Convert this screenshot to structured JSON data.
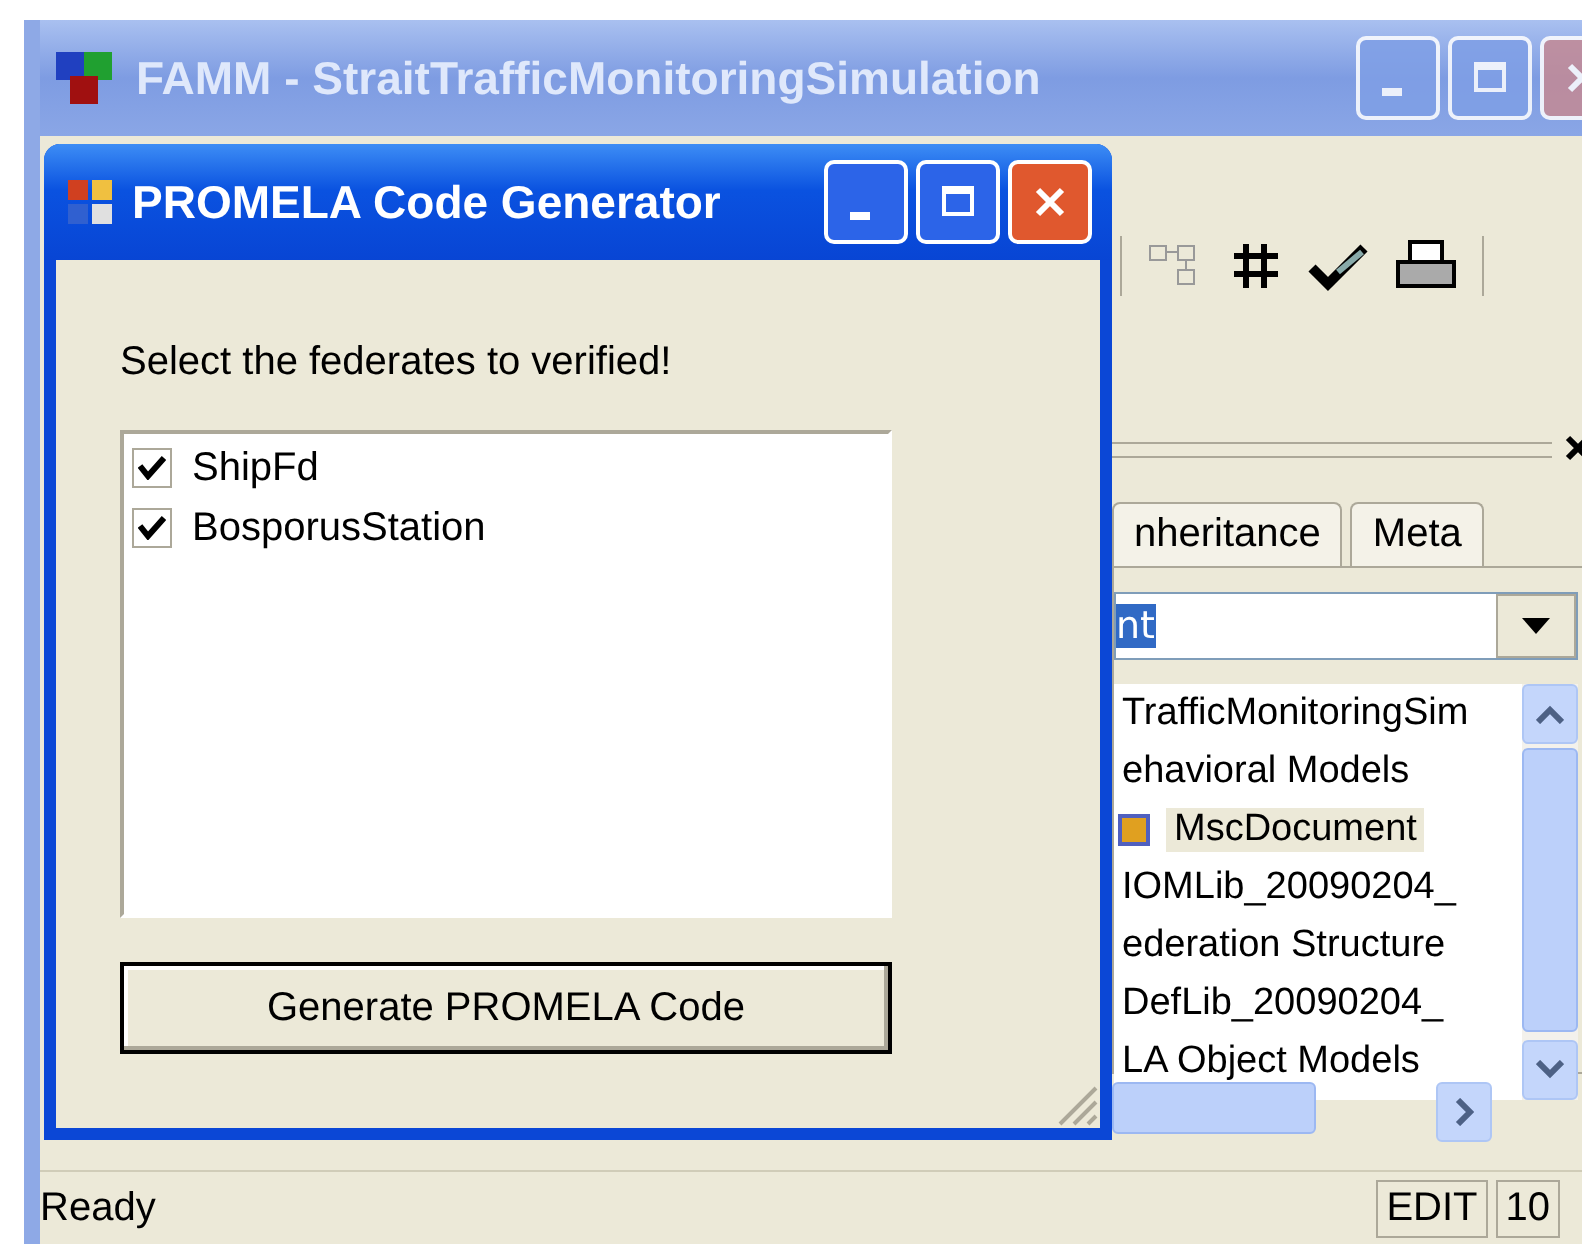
{
  "main_window": {
    "title": "FAMM - StraitTrafficMonitoringSimulation"
  },
  "panel": {
    "tabs": [
      {
        "label": "nheritance",
        "selected": false
      },
      {
        "label": "Meta",
        "selected": false
      }
    ],
    "combo": {
      "value": "nt"
    },
    "tree": [
      {
        "label": "TrafficMonitoringSim",
        "kind": "text",
        "selected": false
      },
      {
        "label": "ehavioral Models",
        "kind": "text",
        "selected": false
      },
      {
        "label": "MscDocument",
        "kind": "document",
        "selected": true
      },
      {
        "label": "IOMLib_20090204_",
        "kind": "text",
        "selected": false
      },
      {
        "label": "ederation Structure",
        "kind": "text",
        "selected": false
      },
      {
        "label": "DefLib_20090204_",
        "kind": "text",
        "selected": false
      },
      {
        "label": "LA Object Models",
        "kind": "text",
        "selected": false
      }
    ]
  },
  "status_bar": {
    "message": "Ready",
    "mode": "EDIT",
    "column_3": "10"
  },
  "dialog": {
    "title": "PROMELA Code Generator",
    "prompt": "Select the federates to verified!",
    "federates": [
      {
        "label": "ShipFd",
        "checked": true
      },
      {
        "label": "BosporusStation",
        "checked": true
      }
    ],
    "button": "Generate PROMELA Code"
  }
}
